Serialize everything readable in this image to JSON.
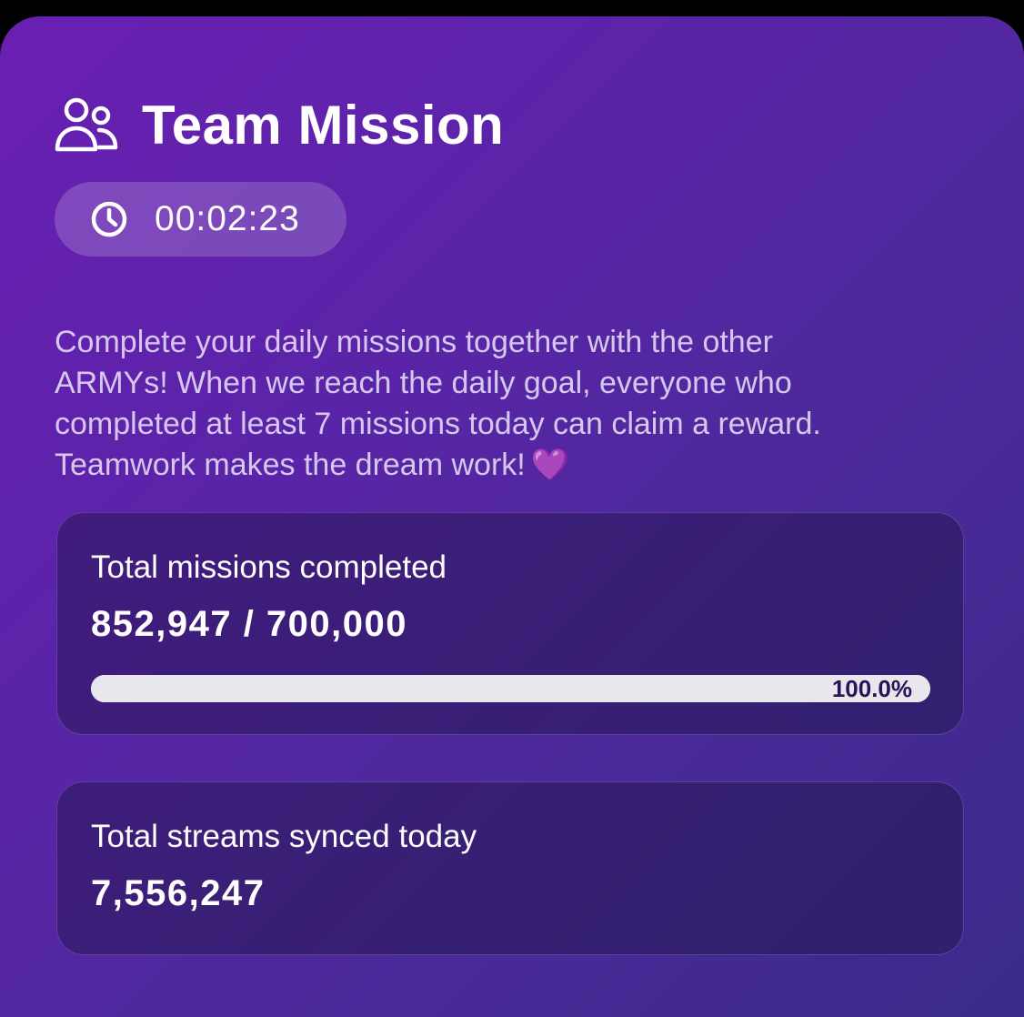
{
  "header": {
    "icon": "team-icon",
    "title": "Team Mission"
  },
  "timer": {
    "icon": "clock-icon",
    "value": "00:02:23"
  },
  "description": {
    "line1": "Complete your daily missions together with the other",
    "line2": "ARMYs! When we reach the daily goal, everyone who",
    "line3": "completed at least 7 missions today can claim a reward.",
    "line4": "Teamwork makes the dream work!",
    "emoji": "💜"
  },
  "missions": {
    "label": "Total missions completed",
    "value": "852,947 / 700,000",
    "progress_text": "100.0%",
    "progress_fraction": 1.0
  },
  "streams": {
    "label": "Total streams synced today",
    "value": "7,556,247"
  },
  "colors": {
    "background_start": "#6a1fb3",
    "background_end": "#3a2a8a",
    "progress_track": "#e9e7ee",
    "progress_text": "#2a1456",
    "heart": "#a857f0"
  }
}
